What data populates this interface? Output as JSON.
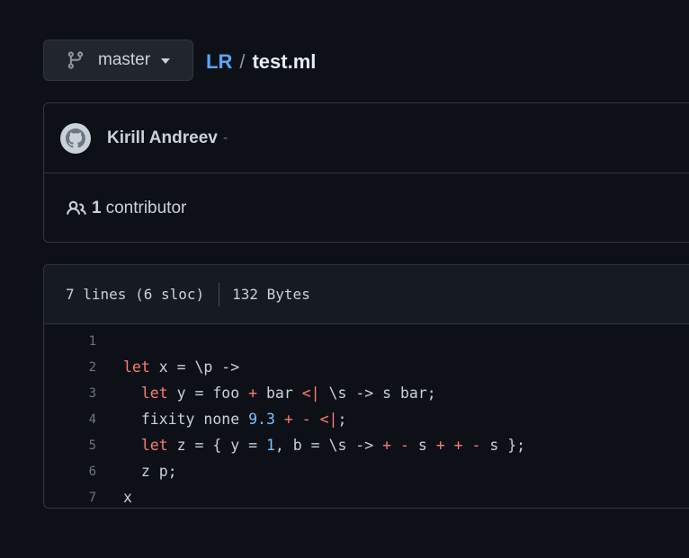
{
  "branch": {
    "label": "master",
    "icon": "git-branch-icon"
  },
  "breadcrumb": {
    "repo": "LR",
    "separator": "/",
    "file": "test.ml"
  },
  "commit": {
    "author": "Kirill Andreev",
    "dash": "-",
    "avatar_icon": "github-avatar-icon"
  },
  "contributors": {
    "count": "1",
    "label": "contributor",
    "icon": "people-icon"
  },
  "file_info": {
    "lines": "7 lines (6 sloc)",
    "size": "132 Bytes"
  },
  "code_lines": [
    {
      "n": "1",
      "tokens": []
    },
    {
      "n": "2",
      "tokens": [
        [
          "kw",
          "let"
        ],
        [
          "t",
          " x = \\p ->"
        ]
      ]
    },
    {
      "n": "3",
      "tokens": [
        [
          "t",
          "  "
        ],
        [
          "kw",
          "let"
        ],
        [
          "t",
          " y = foo "
        ],
        [
          "kw",
          "+"
        ],
        [
          "t",
          " bar "
        ],
        [
          "kw",
          "<|"
        ],
        [
          "t",
          " \\s -> s bar;"
        ]
      ]
    },
    {
      "n": "4",
      "tokens": [
        [
          "t",
          "  fixity none "
        ],
        [
          "num",
          "9.3"
        ],
        [
          "t",
          " "
        ],
        [
          "kw",
          "+"
        ],
        [
          "t",
          " "
        ],
        [
          "kw",
          "-"
        ],
        [
          "t",
          " "
        ],
        [
          "kw",
          "<|"
        ],
        [
          "t",
          ";"
        ]
      ]
    },
    {
      "n": "5",
      "tokens": [
        [
          "t",
          "  "
        ],
        [
          "kw",
          "let"
        ],
        [
          "t",
          " z = { y = "
        ],
        [
          "num",
          "1"
        ],
        [
          "t",
          ", b = \\s -> "
        ],
        [
          "kw",
          "+"
        ],
        [
          "t",
          " "
        ],
        [
          "kw",
          "-"
        ],
        [
          "t",
          " s "
        ],
        [
          "kw",
          "+"
        ],
        [
          "t",
          " "
        ],
        [
          "kw",
          "+"
        ],
        [
          "t",
          " "
        ],
        [
          "kw",
          "-"
        ],
        [
          "t",
          " s };"
        ]
      ]
    },
    {
      "n": "6",
      "tokens": [
        [
          "t",
          "  z p;"
        ]
      ]
    },
    {
      "n": "7",
      "tokens": [
        [
          "t",
          "x"
        ]
      ]
    }
  ],
  "colors": {
    "background": "#0d1117",
    "link": "#58a6ff",
    "keyword": "#ff7b72",
    "number": "#79c0ff"
  }
}
